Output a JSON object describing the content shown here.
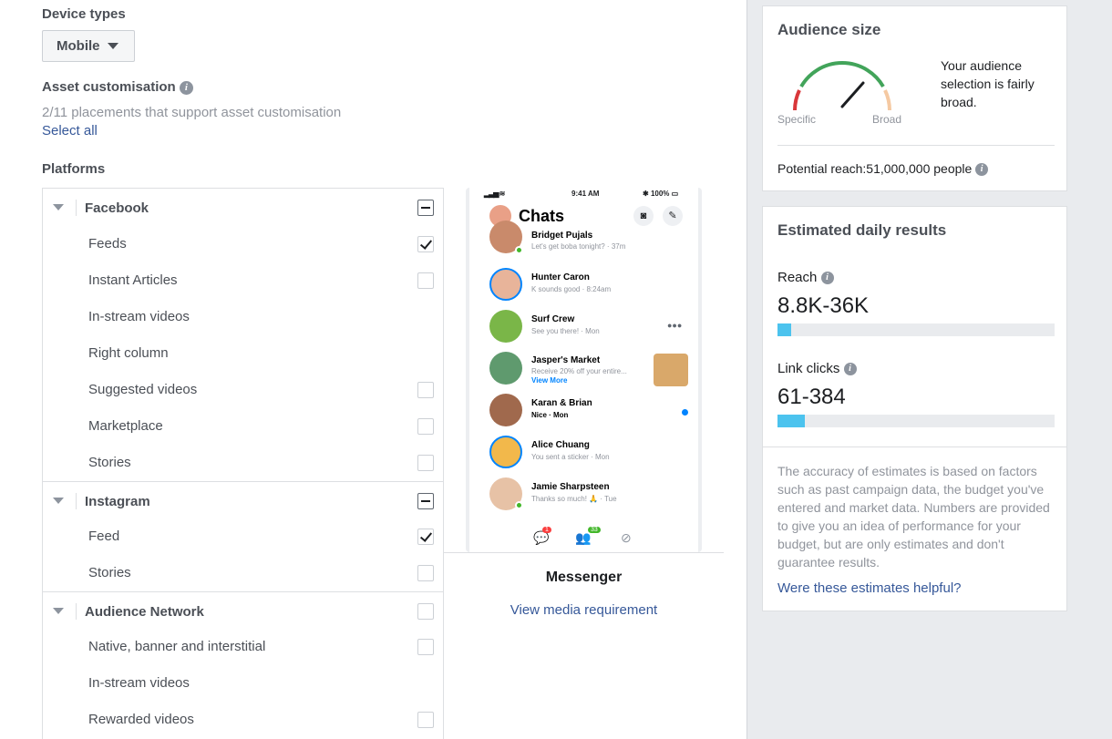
{
  "device_types": {
    "label": "Device types",
    "selected": "Mobile"
  },
  "asset_customisation": {
    "label": "Asset customisation",
    "summary": "2/11 placements that support asset customisation",
    "select_all": "Select all"
  },
  "platforms": {
    "label": "Platforms",
    "facebook": {
      "name": "Facebook",
      "items": [
        "Feeds",
        "Instant Articles",
        "In-stream videos",
        "Right column",
        "Suggested videos",
        "Marketplace",
        "Stories"
      ]
    },
    "instagram": {
      "name": "Instagram",
      "items": [
        "Feed",
        "Stories"
      ]
    },
    "audience_network": {
      "name": "Audience Network",
      "items": [
        "Native, banner and interstitial",
        "In-stream videos",
        "Rewarded videos"
      ]
    }
  },
  "preview": {
    "status_time": "9:41 AM",
    "status_battery": "100%",
    "app_title": "Chats",
    "chats": [
      {
        "name": "Bridget Pujals",
        "sub": "Let's get boba tonight? · 37m"
      },
      {
        "name": "Hunter Caron",
        "sub": "K sounds good · 8:24am"
      },
      {
        "name": "Surf Crew",
        "sub": "See you there! · Mon"
      },
      {
        "name": "Jasper's Market",
        "sub": "Receive 20% off your entire...",
        "cta": "View More"
      },
      {
        "name": "Karan & Brian",
        "sub": "Nice · Mon"
      },
      {
        "name": "Alice Chuang",
        "sub": "You sent a sticker · Mon"
      },
      {
        "name": "Jamie Sharpsteen",
        "sub": "Thanks so much! 🙏 · Tue"
      }
    ],
    "badge_chats": "1",
    "badge_people": "33",
    "title": "Messenger",
    "link": "View media requirement"
  },
  "audience_size": {
    "title": "Audience size",
    "specific": "Specific",
    "broad": "Broad",
    "description": "Your audience selection is fairly broad.",
    "potential_reach": "Potential reach:51,000,000 people"
  },
  "estimated": {
    "title": "Estimated daily results",
    "reach_label": "Reach",
    "reach_value": "8.8K-36K",
    "reach_fill": 0.05,
    "clicks_label": "Link clicks",
    "clicks_value": "61-384",
    "clicks_fill": 0.1,
    "disclaimer": "The accuracy of estimates is based on factors such as past campaign data, the budget you've entered and market data. Numbers are provided to give you an idea of performance for your budget, but are only estimates and don't guarantee results.",
    "helpful": "Were these estimates helpful?"
  },
  "colors": {
    "link": "#365899",
    "bar": "#4cc3ee",
    "gauge_green": "#42a45a",
    "gauge_red": "#d9373a",
    "gauge_peach": "#f5c9a2"
  }
}
